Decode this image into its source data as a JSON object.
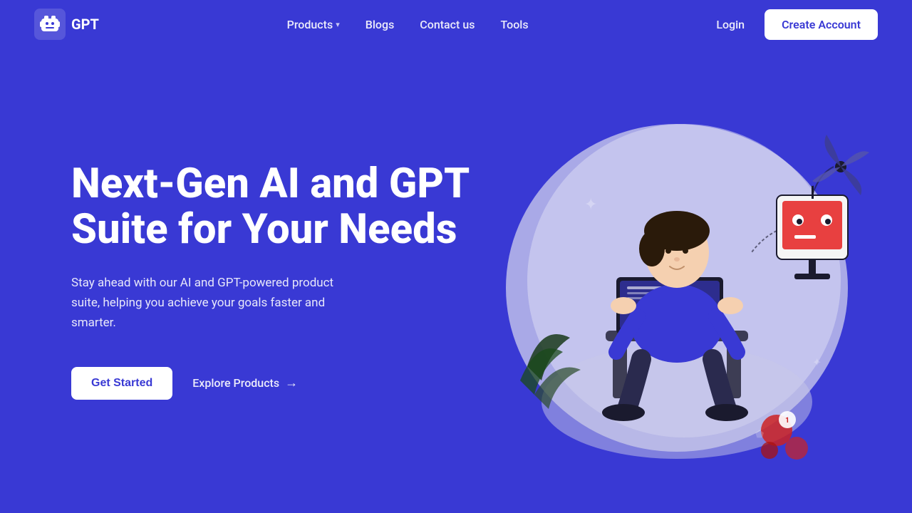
{
  "nav": {
    "logo_text": "GPT",
    "links": [
      {
        "label": "Products",
        "has_dropdown": true
      },
      {
        "label": "Blogs",
        "has_dropdown": false
      },
      {
        "label": "Contact us",
        "has_dropdown": false
      },
      {
        "label": "Tools",
        "has_dropdown": false
      }
    ],
    "login_label": "Login",
    "create_account_label": "Create Account"
  },
  "hero": {
    "title": "Next-Gen AI and GPT Suite for Your Needs",
    "subtitle": "Stay ahead with our AI and GPT-powered product suite, helping you achieve your goals faster and smarter.",
    "get_started_label": "Get Started",
    "explore_products_label": "Explore Products"
  },
  "colors": {
    "background": "#3939d4",
    "white": "#ffffff",
    "blob_fill": "#e8e8f8"
  },
  "icons": {
    "chevron_down": "▾",
    "arrow_right": "→"
  }
}
